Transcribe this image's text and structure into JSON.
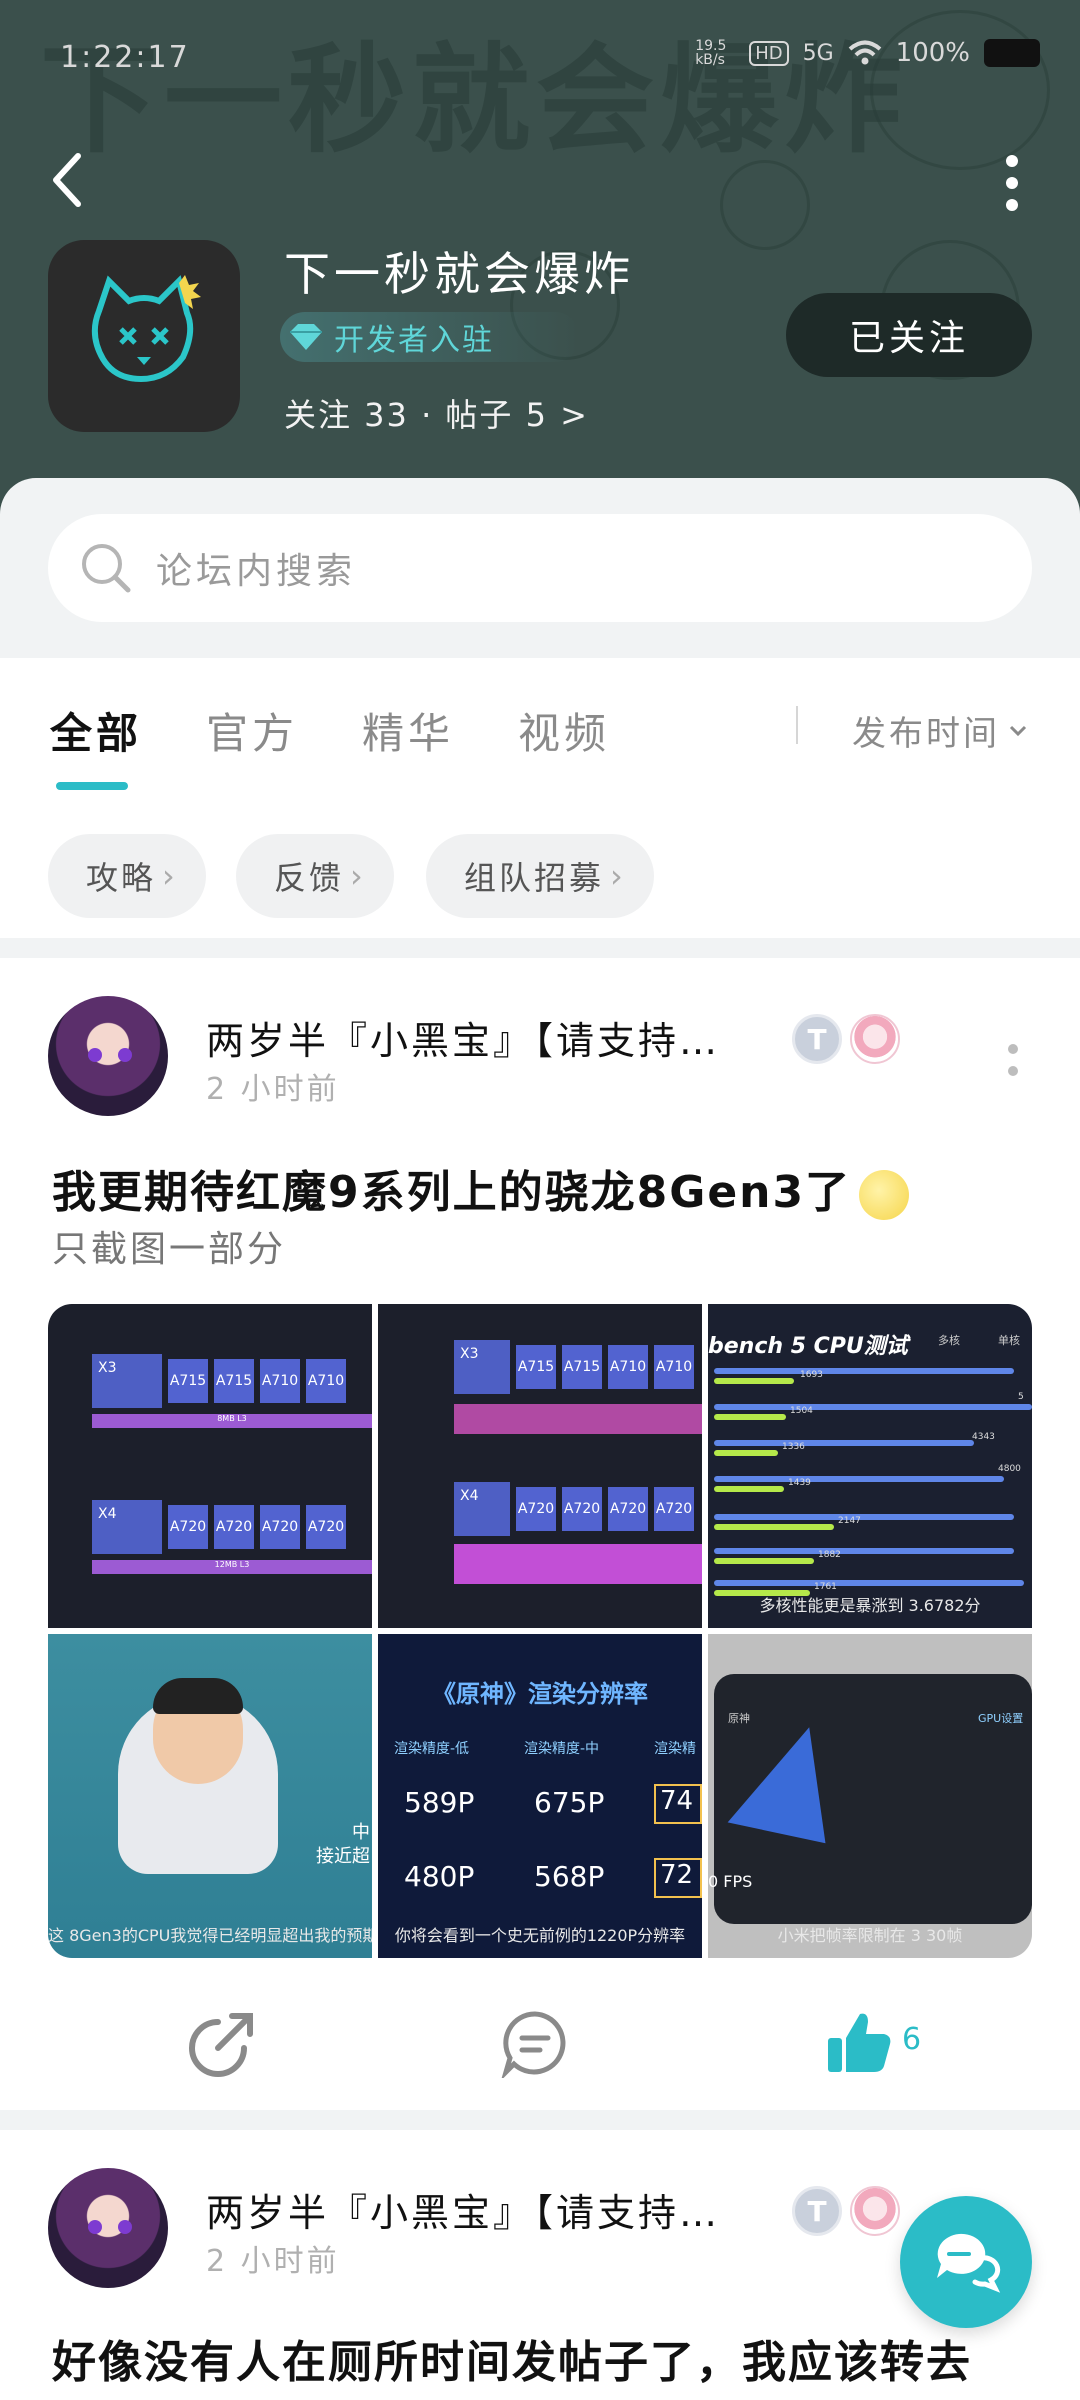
{
  "status_bar": {
    "time": "1:22:17",
    "net_speed": "19.5 kB/s",
    "hd": "HD",
    "network": "5G",
    "battery": "100%"
  },
  "header": {
    "bg_title": "下一秒就会爆炸",
    "app_name": "下一秒就会爆炸",
    "developer_badge": "开发者入驻",
    "stats": "关注 33 · 帖子 5 >",
    "follow_label": "已关注"
  },
  "search": {
    "placeholder": "论坛内搜索"
  },
  "tabs": [
    {
      "label": "全部",
      "active": true
    },
    {
      "label": "官方"
    },
    {
      "label": "精华"
    },
    {
      "label": "视频"
    }
  ],
  "sort_label": "发布时间",
  "chips": [
    {
      "label": "攻略"
    },
    {
      "label": "反馈"
    },
    {
      "label": "组队招募"
    }
  ],
  "posts": [
    {
      "author": "两岁半『小黑宝』【请支持…",
      "time": "2 小时前",
      "title": "我更期待红魔9系列上的骁龙8Gen3了",
      "subtitle": "只截图一部分",
      "images": {
        "c1": {
          "x3": "X3",
          "x4": "X4",
          "a715": "A715",
          "a710": "A710",
          "a720": "A720",
          "l3_8": "8MB L3",
          "l3_12": "12MB L3"
        },
        "c3": {
          "title": "bench 5 CPU测试",
          "legend_multi": "多核",
          "legend_single": "单核",
          "nums": [
            "1693",
            "1504",
            "1336",
            "1439",
            "2147",
            "1882",
            "1761",
            "4343",
            "4800",
            "5"
          ],
          "caption": "多核性能更是暴涨到 3.6782分"
        },
        "c4": {
          "side1": "中",
          "side2": "接近超",
          "caption": "这 8Gen3的CPU我觉得已经明显超出我的预期了"
        },
        "c5": {
          "title": "《原神》渲染分辨率",
          "h_low": "渲染精度-低",
          "h_mid": "渲染精度-中",
          "h_high": "渲染精",
          "v1": "589P",
          "v2": "675P",
          "v3": "74",
          "v4": "480P",
          "v5": "568P",
          "v6": "72",
          "caption": "你将会看到一个史无前例的1220P分辨率"
        },
        "c6": {
          "label1": "原神",
          "label2": "GPU设置",
          "fps": "0 FPS",
          "caption": "小米把帧率限制在 3 30帧"
        }
      },
      "likes": "6"
    },
    {
      "author": "两岁半『小黑宝』【请支持…",
      "time": "2 小时前",
      "title": "好像没有人在厕所时间发帖子了，我应该转去"
    }
  ],
  "colors": {
    "accent": "#2bbcc7",
    "header_bg": "#3b504c"
  }
}
